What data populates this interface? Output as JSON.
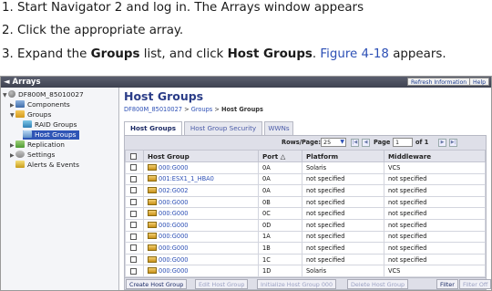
{
  "instructions": {
    "step1": "1. Start Navigator 2 and log in. The Arrays window appears",
    "step2": "2. Click the appropriate array.",
    "step3_a": "3. Expand the ",
    "step3_b": "Groups",
    "step3_c": " list, and click ",
    "step3_d": "Host Groups",
    "step3_e": ". ",
    "step3_f": "Figure 4-18",
    "step3_g": " appears."
  },
  "window": {
    "title": "◄ Arrays",
    "refresh_label": "Refresh Information",
    "help_label": "Help"
  },
  "tree": {
    "array": "DF800M_85010027",
    "components": "Components",
    "groups": "Groups",
    "raid_groups": "RAID Groups",
    "host_groups": "Host Groups",
    "replication": "Replication",
    "settings": "Settings",
    "alerts": "Alerts & Events"
  },
  "main": {
    "title": "Host Groups",
    "crumb_array": "DF800M_85010027",
    "crumb_sep1": " > ",
    "crumb_groups": "Groups",
    "crumb_sep2": " > ",
    "crumb_current": "Host Groups"
  },
  "tabs": {
    "host_groups": "Host Groups",
    "host_group_security": "Host Group Security",
    "wwns": "WWNs"
  },
  "pager": {
    "rows_label": "Rows/Page:",
    "rows_value": "25",
    "page_label": "Page",
    "page_value": "1",
    "of_label": "of 1"
  },
  "table": {
    "headers": {
      "host_group": "Host Group",
      "port": "Port",
      "port_sort": "△",
      "platform": "Platform",
      "middleware": "Middleware"
    },
    "rows": [
      {
        "host_group": "000:G000",
        "port": "0A",
        "platform": "Solaris",
        "middleware": "VCS"
      },
      {
        "host_group": "001:ESX1_1_HBA0",
        "port": "0A",
        "platform": "not specified",
        "middleware": "not specified"
      },
      {
        "host_group": "002:G002",
        "port": "0A",
        "platform": "not specified",
        "middleware": "not specified"
      },
      {
        "host_group": "000:G000",
        "port": "0B",
        "platform": "not specified",
        "middleware": "not specified"
      },
      {
        "host_group": "000:G000",
        "port": "0C",
        "platform": "not specified",
        "middleware": "not specified"
      },
      {
        "host_group": "000:G000",
        "port": "0D",
        "platform": "not specified",
        "middleware": "not specified"
      },
      {
        "host_group": "000:G000",
        "port": "1A",
        "platform": "not specified",
        "middleware": "not specified"
      },
      {
        "host_group": "000:G000",
        "port": "1B",
        "platform": "not specified",
        "middleware": "not specified"
      },
      {
        "host_group": "000:G000",
        "port": "1C",
        "platform": "not specified",
        "middleware": "not specified"
      },
      {
        "host_group": "000:G000",
        "port": "1D",
        "platform": "Solaris",
        "middleware": "VCS"
      }
    ]
  },
  "actions": {
    "create": "Create Host Group",
    "edit": "Edit Host Group",
    "initialize": "Initialize Host Group 000",
    "delete": "Delete Host Group",
    "filter": "Filter",
    "filter_off": "Filter Off"
  }
}
